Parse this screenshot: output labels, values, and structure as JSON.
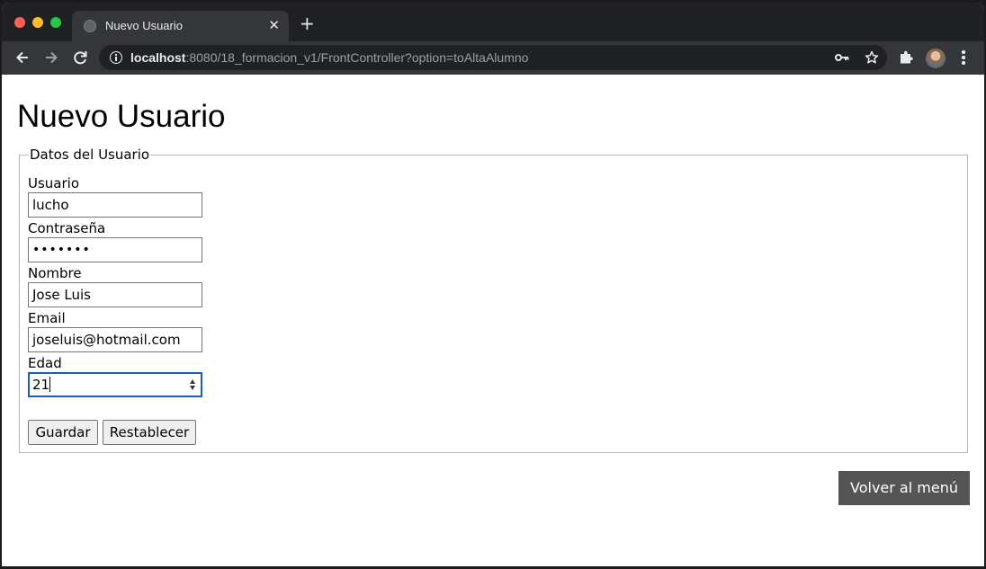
{
  "browser": {
    "tab_title": "Nuevo Usuario",
    "tab_close": "✕",
    "new_tab": "+",
    "url_host": "localhost",
    "url_rest": ":8080/18_formacion_v1/FrontController?option=toAltaAlumno"
  },
  "page": {
    "title": "Nuevo Usuario",
    "fieldset_legend": "Datos del Usuario",
    "fields": {
      "usuario": {
        "label": "Usuario",
        "value": "lucho"
      },
      "password": {
        "label": "Contraseña",
        "value": "•••••••"
      },
      "nombre": {
        "label": "Nombre",
        "value": "Jose Luis"
      },
      "email": {
        "label": "Email",
        "value": "joseluis@hotmail.com"
      },
      "edad": {
        "label": "Edad",
        "value": "21"
      }
    },
    "buttons": {
      "guardar": "Guardar",
      "restablecer": "Restablecer",
      "volver": "Volver al menú"
    }
  },
  "colors": {
    "volver_button_bg": "#555555",
    "focus_border": "#1a5fb4"
  },
  "icons": [
    "back-icon",
    "forward-icon",
    "reload-icon",
    "info-icon",
    "key-icon",
    "star-icon",
    "extensions-icon",
    "avatar",
    "menu-icon"
  ]
}
